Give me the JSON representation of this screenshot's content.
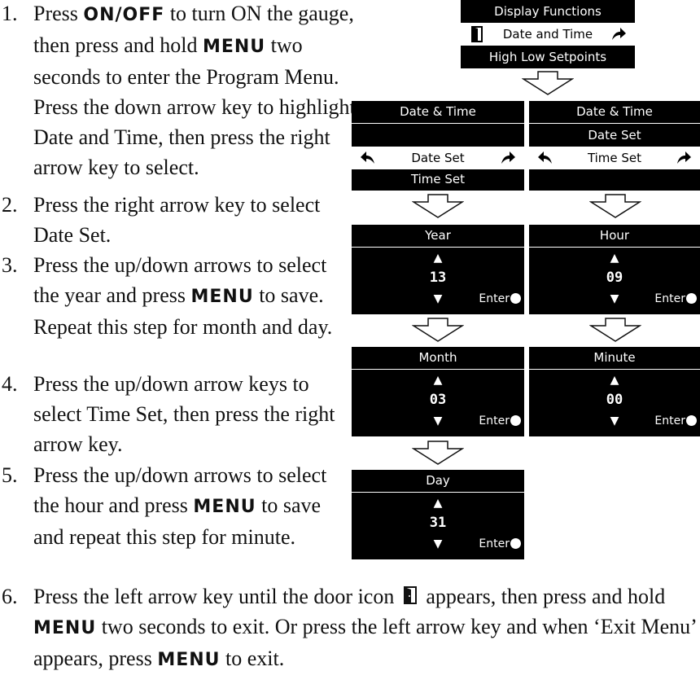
{
  "steps": [
    {
      "num": "1.",
      "parts": [
        {
          "t": "Press "
        },
        {
          "t": "ON/OFF",
          "kw": true
        },
        {
          "t": " to turn ON the gauge, then press and hold "
        },
        {
          "t": "MENU",
          "kw": true
        },
        {
          "t": " two seconds to enter the Program Menu. Press the down arrow key to highlight Date and Time, then press the right arrow key to select."
        }
      ]
    },
    {
      "num": "2.",
      "parts": [
        {
          "t": "Press the right arrow key to select Date Set."
        }
      ]
    },
    {
      "num": "3.",
      "parts": [
        {
          "t": "Press the up/down arrows to select the year and press "
        },
        {
          "t": "MENU",
          "kw": true
        },
        {
          "t": " to save. Repeat this step for month and day."
        }
      ]
    },
    {
      "num": "4.",
      "parts": [
        {
          "t": "Press the up/down arrow keys to select Time Set, then press the right arrow key."
        }
      ]
    },
    {
      "num": "5.",
      "parts": [
        {
          "t": "Press the up/down arrows to select the hour and press "
        },
        {
          "t": "MENU",
          "kw": true
        },
        {
          "t": " to save and repeat this step for minute."
        }
      ]
    },
    {
      "num": "6.",
      "parts": [
        {
          "t": "Press the left arrow key until the door icon "
        },
        {
          "icon": "door-icon"
        },
        {
          "t": " appears, then press and hold "
        },
        {
          "t": "MENU",
          "kw": true
        },
        {
          "t": " two seconds to exit. Or press the left arrow key and when ‘Exit Menu’ appears, press "
        },
        {
          "t": "MENU",
          "kw": true
        },
        {
          "t": " to exit."
        }
      ]
    }
  ],
  "screens": {
    "main_menu": {
      "rows": [
        "Display Functions",
        "Date and Time",
        "High Low Setpoints"
      ],
      "highlight": 1,
      "left_icon": "door-icon",
      "right_icon": "right-arrow-icon"
    },
    "date_time_1": {
      "title": "Date & Time",
      "rows": [
        "",
        "Date Set",
        "Time Set"
      ],
      "highlight": 1,
      "left_icon": "back-arrow-icon",
      "right_icon": "right-arrow-icon"
    },
    "date_time_2": {
      "title": "Date & Time",
      "rows": [
        "Date Set",
        "Time Set",
        ""
      ],
      "highlight": 1,
      "left_icon": "back-arrow-icon",
      "right_icon": "right-arrow-icon"
    },
    "year": {
      "title": "Year",
      "up": "▲",
      "value": "13",
      "down": "▼",
      "enter": "Enter"
    },
    "month": {
      "title": "Month",
      "up": "▲",
      "value": "03",
      "down": "▼",
      "enter": "Enter"
    },
    "day": {
      "title": "Day",
      "up": "▲",
      "value": "31",
      "down": "▼",
      "enter": "Enter"
    },
    "hour": {
      "title": "Hour",
      "up": "▲",
      "value": "09",
      "down": "▼",
      "enter": "Enter"
    },
    "minute": {
      "title": "Minute",
      "up": "▲",
      "value": "00",
      "down": "▼",
      "enter": "Enter"
    }
  }
}
